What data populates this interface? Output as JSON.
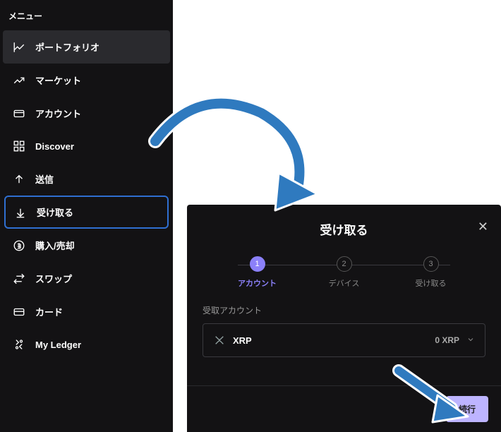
{
  "sidebar": {
    "menu_label": "メニュー",
    "items": [
      {
        "label": "ポートフォリオ"
      },
      {
        "label": "マーケット"
      },
      {
        "label": "アカウント"
      },
      {
        "label": "Discover"
      },
      {
        "label": "送信"
      },
      {
        "label": "受け取る"
      },
      {
        "label": "購入/売却"
      },
      {
        "label": "スワップ"
      },
      {
        "label": "カード"
      },
      {
        "label": "My Ledger"
      }
    ]
  },
  "modal": {
    "title": "受け取る",
    "steps": [
      {
        "num": "1",
        "label": "アカウント"
      },
      {
        "num": "2",
        "label": "デバイス"
      },
      {
        "num": "3",
        "label": "受け取る"
      }
    ],
    "field_label": "受取アカウント",
    "account": {
      "name": "XRP",
      "balance": "0 XRP"
    },
    "continue_label": "続行"
  }
}
